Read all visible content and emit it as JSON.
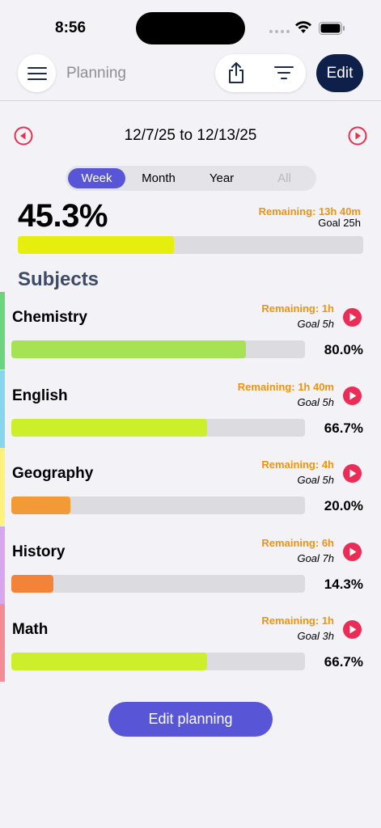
{
  "status_bar": {
    "time": "8:56"
  },
  "header": {
    "title": "Planning",
    "edit_label": "Edit"
  },
  "period": {
    "range": "12/7/25 to 12/13/25",
    "tabs": [
      {
        "label": "Week",
        "state": "active"
      },
      {
        "label": "Month",
        "state": "normal"
      },
      {
        "label": "Year",
        "state": "normal"
      },
      {
        "label": "All",
        "state": "disabled"
      }
    ]
  },
  "overall": {
    "percent_text": "45.3%",
    "progress": 0.453,
    "remaining": "Remaining: 13h 40m",
    "goal": "Goal 25h",
    "bar_color": "#e5ee0c"
  },
  "section_title": "Subjects",
  "subjects": [
    {
      "name": "Chemistry",
      "remaining": "Remaining: 1h",
      "goal": "Goal 5h",
      "percent_text": "80.0%",
      "progress": 0.8,
      "stripe_color": "#6dd47e",
      "bar_color": "#a6e253"
    },
    {
      "name": "English",
      "remaining": "Remaining: 1h 40m",
      "goal": "Goal 5h",
      "percent_text": "66.7%",
      "progress": 0.667,
      "stripe_color": "#86d6ee",
      "bar_color": "#cdee2a"
    },
    {
      "name": "Geography",
      "remaining": "Remaining: 4h",
      "goal": "Goal 5h",
      "percent_text": "20.0%",
      "progress": 0.2,
      "stripe_color": "#fff27a",
      "bar_color": "#f29a35"
    },
    {
      "name": "History",
      "remaining": "Remaining: 6h",
      "goal": "Goal 7h",
      "percent_text": "14.3%",
      "progress": 0.143,
      "stripe_color": "#d7a6ec",
      "bar_color": "#f2843a"
    },
    {
      "name": "Math",
      "remaining": "Remaining: 1h",
      "goal": "Goal 3h",
      "percent_text": "66.7%",
      "progress": 0.667,
      "stripe_color": "#f58b95",
      "bar_color": "#cdee2a"
    }
  ],
  "edit_planning_label": "Edit planning",
  "colors": {
    "accent": "#5856d6",
    "orange": "#f0930f",
    "play_red": "#ea2c56",
    "navy": "#0e1f4a"
  },
  "icons": [
    "menu-icon",
    "share-icon",
    "filter-icon",
    "previous-icon",
    "next-icon",
    "play-icon",
    "wifi-icon",
    "battery-icon",
    "signal-icon"
  ]
}
